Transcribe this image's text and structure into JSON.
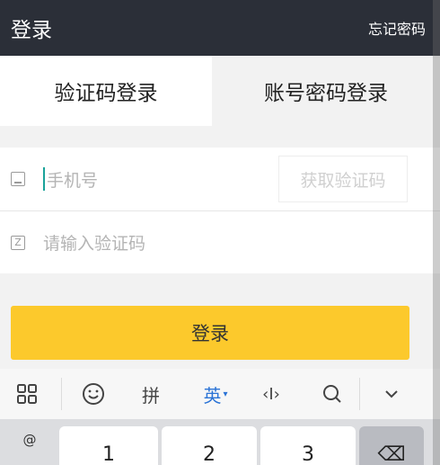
{
  "header": {
    "title": "登录",
    "link": "忘记密码"
  },
  "tabs": [
    {
      "label": "验证码登录",
      "active": true
    },
    {
      "label": "账号密码登录",
      "active": false
    }
  ],
  "form": {
    "phone_placeholder": "手机号",
    "get_code_label": "获取验证码",
    "code_placeholder": "请输入验证码"
  },
  "login_button": "登录",
  "keyboard": {
    "toolbar": {
      "pinyin": "拼",
      "english": "英",
      "cursor": "‹I›",
      "search": "Q",
      "collapse": "∨"
    },
    "keys": [
      "@",
      "1",
      "2",
      "3",
      "⌫"
    ]
  },
  "colors": {
    "header_bg": "#2b2f38",
    "accent_yellow": "#fcc92c",
    "cursor_teal": "#1aa39a",
    "keyboard_blue": "#2a73d6"
  }
}
